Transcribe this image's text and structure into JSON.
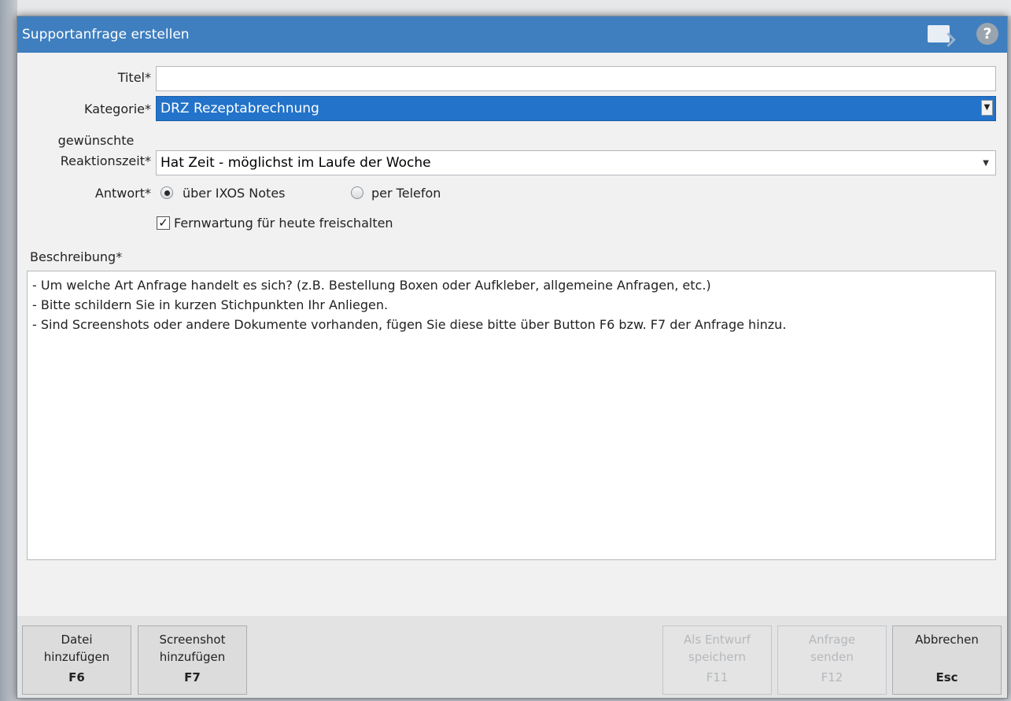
{
  "window": {
    "title": "Supportanfrage erstellen"
  },
  "form": {
    "title_label": "Titel*",
    "title_value": "",
    "category_label": "Kategorie*",
    "category_value": "DRZ Rezeptabrechnung",
    "reaction_label_line1": "gewünschte",
    "reaction_label_line2": "Reaktionszeit*",
    "reaction_value": "Hat Zeit - möglichst im Laufe der Woche",
    "answer_label": "Antwort*",
    "answer_options": [
      {
        "label": "über IXOS Notes",
        "checked": true
      },
      {
        "label": "per Telefon",
        "checked": false
      }
    ],
    "remote_label": "Fernwartung für heute freischalten",
    "remote_checked": true,
    "description_label": "Beschreibung*",
    "description_lines": [
      "- Um welche Art Anfrage handelt es sich? (z.B. Bestellung Boxen oder Aufkleber, allgemeine Anfragen, etc.)",
      "- Bitte schildern Sie in kurzen Stichpunkten Ihr Anliegen.",
      "- Sind Screenshots oder andere Dokumente vorhanden, fügen Sie diese bitte über Button F6 bzw. F7 der Anfrage hinzu."
    ]
  },
  "buttons": {
    "add_file": {
      "line1": "Datei",
      "line2": "hinzufügen",
      "key": "F6",
      "enabled": true
    },
    "add_screenshot": {
      "line1": "Screenshot",
      "line2": "hinzufügen",
      "key": "F7",
      "enabled": true
    },
    "save_draft": {
      "line1": "Als Entwurf",
      "line2": "speichern",
      "key": "F11",
      "enabled": false
    },
    "send_request": {
      "line1": "Anfrage",
      "line2": "senden",
      "key": "F12",
      "enabled": false
    },
    "cancel": {
      "line1": "Abbrechen",
      "line2": "",
      "key": "Esc",
      "enabled": true
    }
  },
  "colors": {
    "titlebar": "#3f7fbf",
    "selection": "#2273c9"
  },
  "icons": {
    "title_right_1": "document-export-icon",
    "title_right_2": "help-icon"
  }
}
